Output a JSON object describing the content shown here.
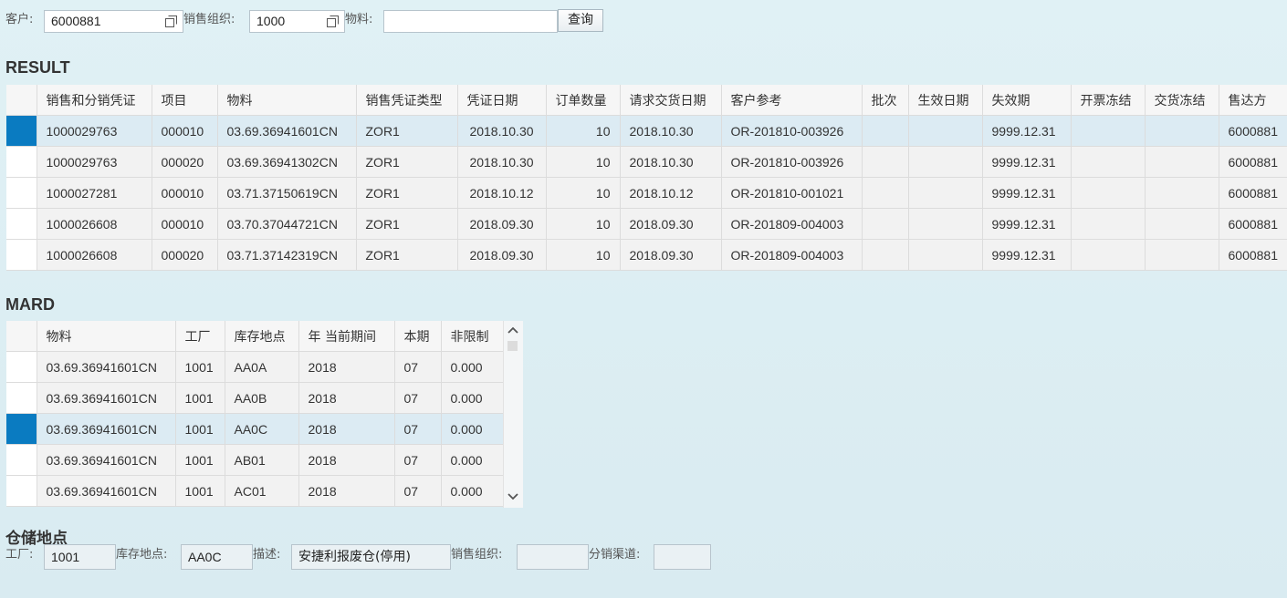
{
  "filter": {
    "customer_label": "客户:",
    "customer_value": "6000881",
    "salesorg_label": "销售组织:",
    "salesorg_value": "1000",
    "material_label": "物料:",
    "material_value": "",
    "query_button": "查询"
  },
  "result": {
    "title": "RESULT",
    "columns": [
      "销售和分销凭证",
      "项目",
      "物料",
      "销售凭证类型",
      "凭证日期",
      "订单数量",
      "请求交货日期",
      "客户参考",
      "批次",
      "生效日期",
      "失效期",
      "开票冻结",
      "交货冻结",
      "售达方"
    ],
    "rows": [
      [
        "1000029763",
        "000010",
        "03.69.36941601CN",
        "ZOR1",
        "2018.10.30",
        "10",
        "2018.10.30",
        "OR-201810-003926",
        "",
        "",
        "9999.12.31",
        "",
        "",
        "6000881"
      ],
      [
        "1000029763",
        "000020",
        "03.69.36941302CN",
        "ZOR1",
        "2018.10.30",
        "10",
        "2018.10.30",
        "OR-201810-003926",
        "",
        "",
        "9999.12.31",
        "",
        "",
        "6000881"
      ],
      [
        "1000027281",
        "000010",
        "03.71.37150619CN",
        "ZOR1",
        "2018.10.12",
        "10",
        "2018.10.12",
        "OR-201810-001021",
        "",
        "",
        "9999.12.31",
        "",
        "",
        "6000881"
      ],
      [
        "1000026608",
        "000010",
        "03.70.37044721CN",
        "ZOR1",
        "2018.09.30",
        "10",
        "2018.09.30",
        "OR-201809-004003",
        "",
        "",
        "9999.12.31",
        "",
        "",
        "6000881"
      ],
      [
        "1000026608",
        "000020",
        "03.71.37142319CN",
        "ZOR1",
        "2018.09.30",
        "10",
        "2018.09.30",
        "OR-201809-004003",
        "",
        "",
        "9999.12.31",
        "",
        "",
        "6000881"
      ]
    ]
  },
  "mard": {
    "title": "MARD",
    "columns": [
      "物料",
      "工厂",
      "库存地点",
      "年 当前期间",
      "本期",
      "非限制"
    ],
    "rows": [
      [
        "03.69.36941601CN",
        "1001",
        "AA0A",
        "2018",
        "07",
        "0.000"
      ],
      [
        "03.69.36941601CN",
        "1001",
        "AA0B",
        "2018",
        "07",
        "0.000"
      ],
      [
        "03.69.36941601CN",
        "1001",
        "AA0C",
        "2018",
        "07",
        "0.000"
      ],
      [
        "03.69.36941601CN",
        "1001",
        "AB01",
        "2018",
        "07",
        "0.000"
      ],
      [
        "03.69.36941601CN",
        "1001",
        "AC01",
        "2018",
        "07",
        "0.000"
      ]
    ]
  },
  "storage": {
    "title": "仓储地点",
    "plant_label": "工厂:",
    "plant_value": "1001",
    "location_label": "库存地点:",
    "location_value": "AA0C",
    "desc_label": "描述:",
    "desc_value": "安捷利报废仓(停用)",
    "salesorg_label": "销售组织:",
    "salesorg_value": "",
    "channel_label": "分销渠道:",
    "channel_value": ""
  },
  "colors": {
    "selected_marker": "#0a7bc1",
    "selected_row": "#dcebf3"
  }
}
